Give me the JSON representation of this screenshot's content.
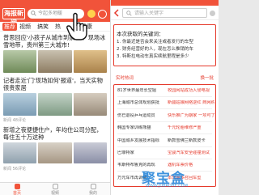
{
  "left": {
    "logo_text": "海报新闻",
    "search_placeholder": "今起多地暖",
    "tabs": [
      {
        "label": "推荐",
        "active": true
      },
      {
        "label": "视频",
        "active": false
      },
      {
        "label": "搞笑",
        "active": false
      },
      {
        "label": "热",
        "active": false
      },
      {
        "label": "健康",
        "active": false
      }
    ],
    "articles": [
      {
        "title": "普思回应'小孩子从城市到家里'，现场冰雪地带，贵州第三大城市!"
      },
      {
        "title": "记者走近'门'现场如何'报道'，当天实物很贵家居",
        "meta": "新闻  48评论"
      },
      {
        "title": "新增之夜便捷住户，年均住公司分配，每住五十万这种",
        "meta": "新闻  56评论"
      }
    ],
    "nav": [
      {
        "label": "首页",
        "active": true
      },
      {
        "label": "视频",
        "active": false
      },
      {
        "label": "我的",
        "active": false
      }
    ]
  },
  "right": {
    "search_placeholder": "请输入关键字",
    "keywords_title": "本次获取的关键词：",
    "keyword_lines": [
      "1. 你最近是否会来关注或者发行的车型",
      "2. 财务经营好的人，现在怎么推销的车",
      "3. 特斯拉电动车真实续航里程是多少"
    ],
    "hot_label": "实时热词",
    "change_label": "换一批",
    "hot_words": [
      {
        "left": "81岁世界最年长空姐",
        "right": "校园网站成功入侵电视",
        "right_red": true
      },
      {
        "left": "上海城市总体规划获批",
        "right": "新疆姑娘网络逆红 商网购买",
        "right_red": true
      },
      {
        "left": "伤已退役乒乓运动员",
        "right": "快乐推广为期家 一项可了",
        "right_red": true
      },
      {
        "left": "韩国专家训练熊猫",
        "right": "千元轮胎维修严重",
        "right_red": true
      },
      {
        "left": "中国城乡发展技术指标",
        "right": "新款雪佛兰新款皮卡",
        "right_red": false
      },
      {
        "left": "巴菲特家",
        "right": "宝骏汽车安全碰撞测试",
        "right_red": true
      },
      {
        "left": "韦斯特布鲁克的再现",
        "right": "遇机车票价格",
        "right_red": true
      },
      {
        "left": "万元车市再调整",
        "right": "本田最多召回车型",
        "right_red": true
      }
    ]
  },
  "watermark": {
    "text": "聚宝盒",
    "sub": "WWW.JUBAOHE.COM"
  },
  "colors": {
    "brand": "#f1533a",
    "highlight": "#e53a2c",
    "watermark": "#1d7fd6"
  }
}
